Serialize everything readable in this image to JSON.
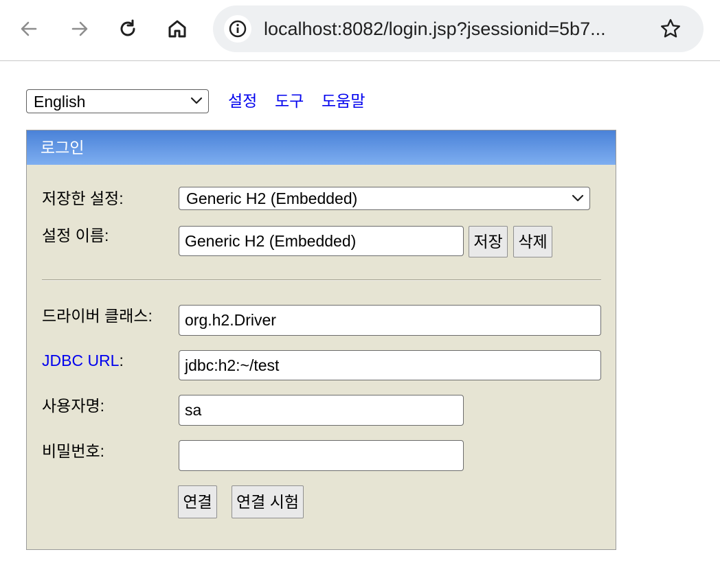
{
  "browser": {
    "url": "localhost:8082/login.jsp?jsessionid=5b7...",
    "icons": [
      "back-icon",
      "forward-icon",
      "reload-icon",
      "home-icon",
      "site-info-icon",
      "bookmark-star-icon"
    ]
  },
  "top": {
    "language_selected": "English",
    "links": [
      "설정",
      "도구",
      "도움말"
    ]
  },
  "login": {
    "title": "로그인",
    "saved_settings_label": "저장한 설정:",
    "saved_settings_value": "Generic H2 (Embedded)",
    "setting_name_label": "설정 이름:",
    "setting_name_value": "Generic H2 (Embedded)",
    "save_button": "저장",
    "delete_button": "삭제",
    "driver_class_label": "드라이버 클래스:",
    "driver_class_value": "org.h2.Driver",
    "jdbc_url_label": "JDBC URL",
    "jdbc_url_colon": ":",
    "jdbc_url_value": "jdbc:h2:~/test",
    "username_label": "사용자명:",
    "username_value": "sa",
    "password_label": "비밀번호:",
    "password_value": "",
    "connect_button": "연결",
    "test_connection_button": "연결 시험"
  },
  "colors": {
    "panel_bg": "#e6e4d3",
    "header_gradient_top": "#4a82d8",
    "header_gradient_bottom": "#7eaef0",
    "link": "#0000ee"
  }
}
